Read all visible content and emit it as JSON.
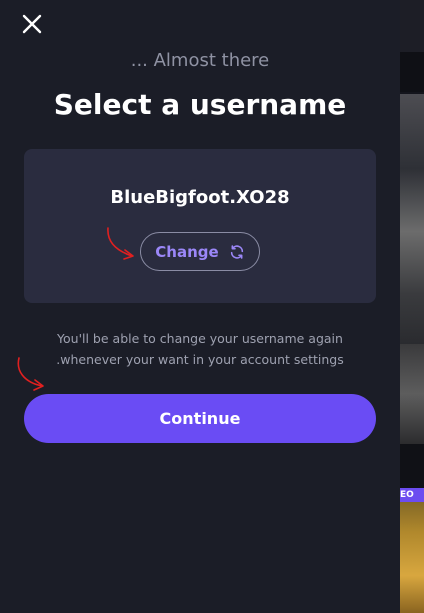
{
  "modal": {
    "close_icon": "close-icon",
    "subtitle": "... Almost there",
    "title": "Select a username",
    "username": "BlueBigfoot.XO28",
    "change_label": "Change",
    "change_icon": "refresh-icon",
    "note_line1": "You'll be able to change your username again",
    "note_line2": ".whenever your want in your account settings",
    "continue_label": "Continue"
  },
  "background": {
    "badge_text": "EO"
  },
  "colors": {
    "panel_bg": "#1b1d27",
    "card_bg": "#2a2c3f",
    "accent": "#6a4cf4",
    "change_text": "#9b87f8",
    "annotation_arrow": "#e02020"
  }
}
